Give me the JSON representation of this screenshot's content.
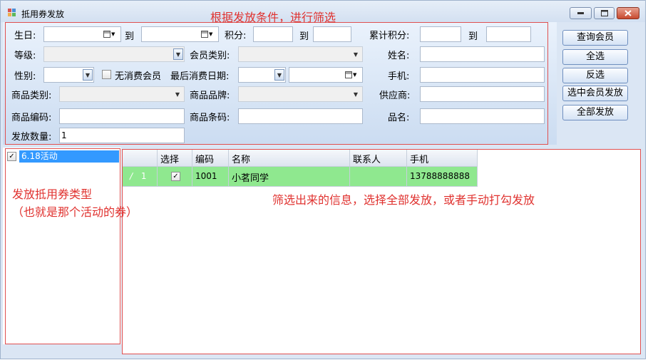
{
  "window": {
    "title": "抵用券发放"
  },
  "annotations": {
    "filter": "根据发放条件，进行筛选",
    "type_line1": "发放抵用券类型",
    "type_line2": "（也就是那个活动的券）",
    "grid": "筛选出来的信息，选择全部发放，或者手动打勾发放"
  },
  "filter": {
    "birthday": "生日:",
    "to": "到",
    "points": "积分:",
    "cumulative_points": "累计积分:",
    "level": "等级:",
    "member_type": "会员类别:",
    "name": "姓名:",
    "gender": "性别:",
    "no_consumption": "无消费会员",
    "last_consume_date": "最后消费日期:",
    "phone": "手机:",
    "product_category": "商品类别:",
    "product_brand": "商品品牌:",
    "supplier": "供应商:",
    "product_code": "商品编码:",
    "barcode": "商品条码:",
    "product_name": "品名:",
    "issue_qty": "发放数量:",
    "issue_qty_value": "1"
  },
  "actions": {
    "query": "查询会员",
    "select_all": "全选",
    "invert": "反选",
    "issue_selected": "选中会员发放",
    "issue_all": "全部发放"
  },
  "tree": {
    "item": "6.18活动"
  },
  "grid": {
    "headers": [
      "选择",
      "编码",
      "名称",
      "联系人",
      "手机"
    ],
    "rows": [
      {
        "index": "1",
        "code": "1001",
        "name": "小茗同学",
        "contact": "",
        "phone": "13788888888"
      }
    ]
  }
}
